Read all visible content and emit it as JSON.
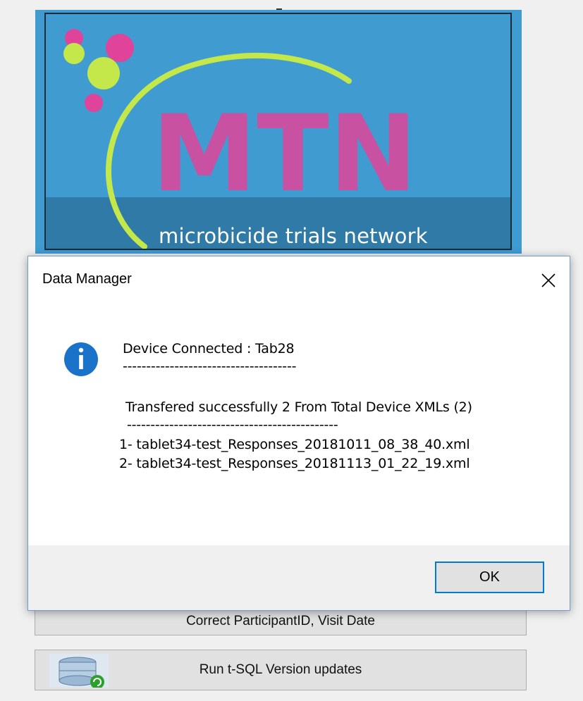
{
  "banner": {
    "logo_text": "MTN",
    "tagline": "microbicide trials network",
    "colors": {
      "background": "#3f9bd0",
      "strip": "#2f7aa6",
      "pink": "#e0449a",
      "lime": "#c4e84a"
    }
  },
  "buttons": {
    "correct_participant": "Correct ParticipantID, Visit Date",
    "run_tsql": "Run t-SQL Version updates",
    "tsql_icon": "database-update-icon"
  },
  "dialog": {
    "title": "Data Manager",
    "close_icon": "close-icon",
    "info_icon": "info-icon",
    "accent_color": "#0078d7",
    "lines": [
      "Device Connected : Tab28",
      "-------------------------------------",
      "Transfered successfully 2 From Total Device XMLs (2)",
      "---------------------------------------------",
      "1- tablet34-test_Responses_20181011_08_38_40.xml",
      "2- tablet34-test_Responses_20181113_01_22_19.xml"
    ],
    "ok_label": "OK"
  }
}
